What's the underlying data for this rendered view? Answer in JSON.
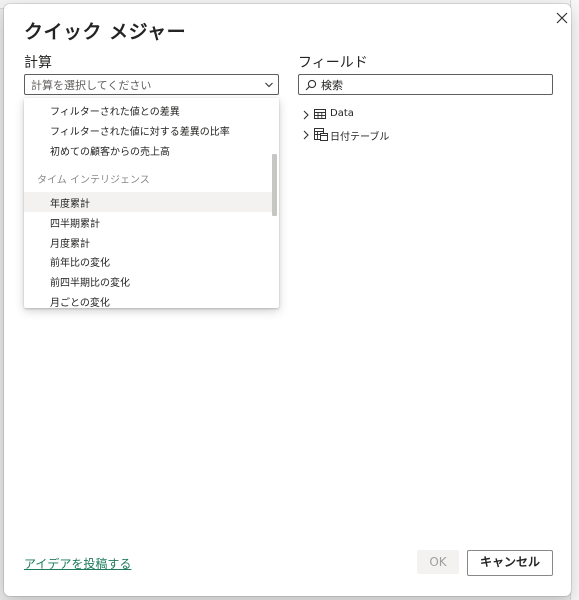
{
  "dialog": {
    "title": "クイック メジャー"
  },
  "calc": {
    "label": "計算",
    "placeholder": "計算を選択してください",
    "items_top": [
      "フィルターされた値との差異",
      "フィルターされた値に対する差異の比率",
      "初めての顧客からの売上高"
    ],
    "group_header": "タイム インテリジェンス",
    "items_time": [
      "年度累計",
      "四半期累計",
      "月度累計",
      "前年比の変化",
      "前四半期比の変化",
      "月ごとの変化"
    ],
    "selected": "年度累計"
  },
  "fields": {
    "label": "フィールド",
    "search_placeholder": "検索",
    "tree": [
      {
        "label": "Data",
        "icon": "table-icon"
      },
      {
        "label": "日付テーブル",
        "icon": "date-table-icon"
      }
    ]
  },
  "footer": {
    "idea_link": "アイデアを投稿する",
    "ok_label": "OK",
    "cancel_label": "キャンセル"
  }
}
